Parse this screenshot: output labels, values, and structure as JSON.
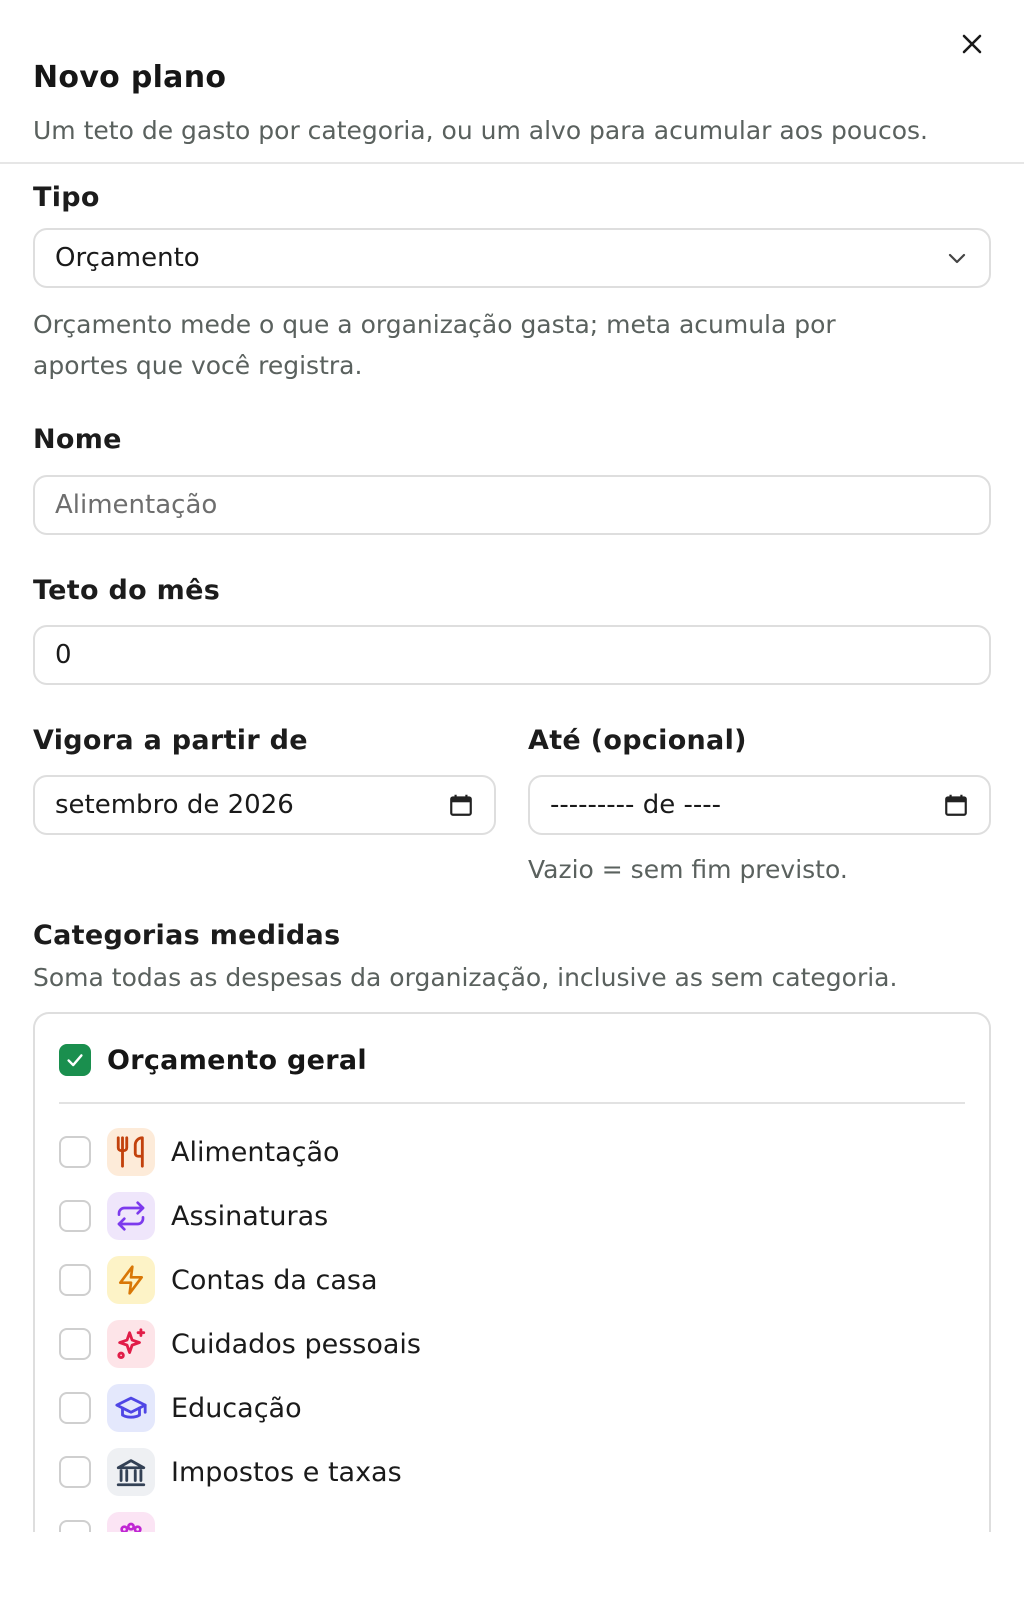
{
  "header": {
    "title": "Novo plano",
    "subtitle": "Um teto de gasto por categoria, ou um alvo para acumular aos poucos."
  },
  "tipo": {
    "label": "Tipo",
    "value": "Orçamento",
    "help": "Orçamento mede o que a organização gasta; meta acumula por aportes que você registra."
  },
  "nome": {
    "label": "Nome",
    "placeholder": "Alimentação"
  },
  "teto": {
    "label": "Teto do mês",
    "value": "0"
  },
  "vigora": {
    "label": "Vigora a partir de",
    "value": "setembro de 2026"
  },
  "ate": {
    "label": "Até (opcional)",
    "value": "--------- de ----",
    "help": "Vazio = sem fim previsto."
  },
  "categorias": {
    "label": "Categorias medidas",
    "help": "Soma todas as despesas da organização, inclusive as sem categoria.",
    "general": {
      "label": "Orçamento geral",
      "checked": true
    },
    "items": [
      {
        "label": "Alimentação",
        "icon": "fork-knife-icon",
        "bg": "#fdebd9",
        "color": "#c2410c"
      },
      {
        "label": "Assinaturas",
        "icon": "repeat-icon",
        "bg": "#efe6fb",
        "color": "#7c3aed"
      },
      {
        "label": "Contas da casa",
        "icon": "lightning-icon",
        "bg": "#fdf3c7",
        "color": "#d97706"
      },
      {
        "label": "Cuidados pessoais",
        "icon": "sparkles-icon",
        "bg": "#fde4e8",
        "color": "#e11d48"
      },
      {
        "label": "Educação",
        "icon": "graduation-cap-icon",
        "bg": "#e4e8fc",
        "color": "#4f46e5"
      },
      {
        "label": "Impostos e taxas",
        "icon": "bank-icon",
        "bg": "#eef0f3",
        "color": "#334155"
      },
      {
        "label": "",
        "icon": "paw-icon",
        "bg": "#fbe4f4",
        "color": "#c026d3"
      }
    ]
  },
  "colors": {
    "accent": "#1a8f4e",
    "border": "#dedede",
    "muted": "#5a615e"
  }
}
